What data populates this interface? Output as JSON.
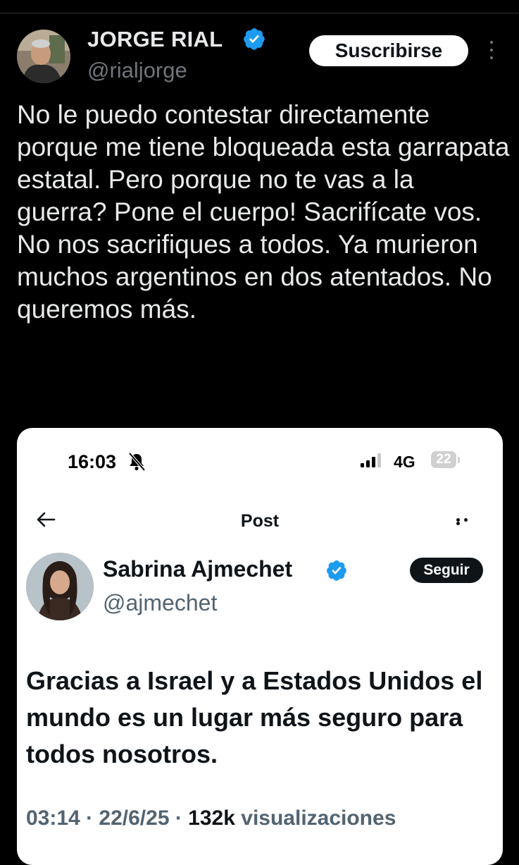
{
  "tweet": {
    "author_name": "JORGE RIAL",
    "author_handle": "@rialjorge",
    "subscribe_label": "Suscribirse",
    "text": "No le puedo contestar directamente porque me tiene bloqueada esta garrapata estatal. Pero porque no te vas a la guerra? Pone el cuerpo! Sacrifícate vos. No nos sacrifiques a todos. Ya murieron muchos argentinos en dos atentados. No queremos más.",
    "verified_color": "#1d9bf0"
  },
  "embedded": {
    "status_bar": {
      "time": "16:03",
      "network": "4G",
      "battery": "22"
    },
    "nav": {
      "title": "Post"
    },
    "post": {
      "author_name": "Sabrina Ajmechet",
      "author_handle": "@ajmechet",
      "follow_label": "Seguir",
      "text": "Gracias a Israel y a Estados Unidos el mundo es un lugar más seguro para todos nosotros.",
      "time": "03:14",
      "date": "22/6/25",
      "views_count": "132k",
      "views_label": "visualizaciones"
    }
  }
}
